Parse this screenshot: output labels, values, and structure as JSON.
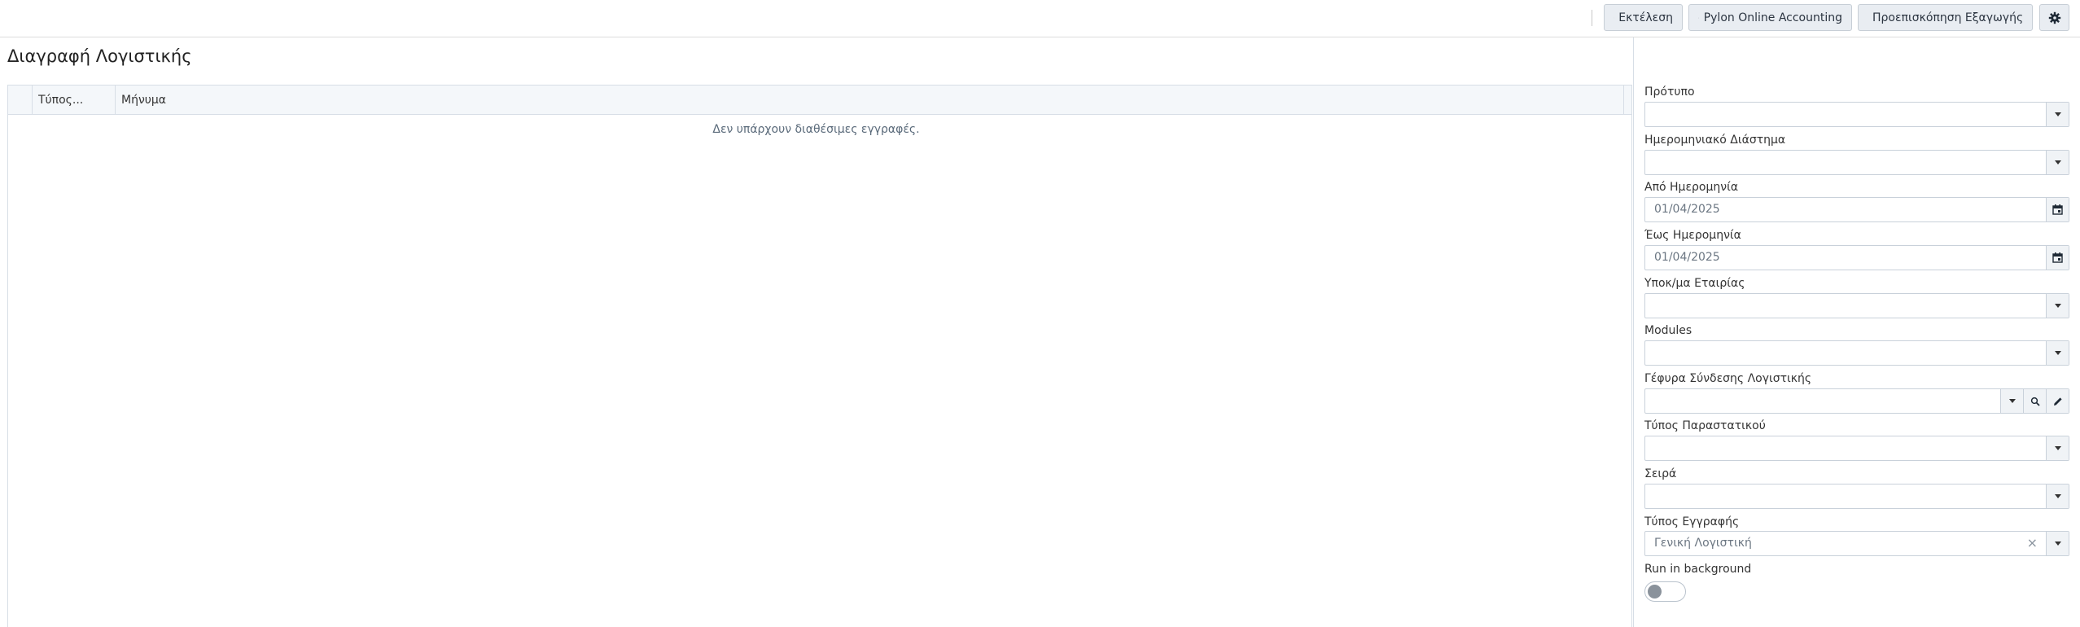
{
  "toolbar": {
    "execute_label": "Εκτέλεση",
    "pylon_label": "Pylon Online Accounting",
    "preview_label": "Προεπισκόπηση Εξαγωγής"
  },
  "page": {
    "title": "Διαγραφή Λογιστικής"
  },
  "grid": {
    "columns": [
      "Τύπος...",
      "Μήνυμα"
    ],
    "empty_text": "Δεν υπάρχουν διαθέσιμες εγγραφές."
  },
  "form": {
    "template_label": "Πρότυπο",
    "template_value": "",
    "date_range_label": "Ημερομηνιακό Διάστημα",
    "date_range_value": "",
    "from_date_label": "Από Ημερομηνία",
    "from_date_value": "01/04/2025",
    "to_date_label": "Έως Ημερομηνία",
    "to_date_value": "01/04/2025",
    "company_branch_label": "Υποκ/μα Εταιρίας",
    "company_branch_value": "",
    "modules_label": "Modules",
    "modules_value": "",
    "bridge_label": "Γέφυρα Σύνδεσης Λογιστικής",
    "bridge_value": "",
    "doc_type_label": "Τύπος Παραστατικού",
    "doc_type_value": "",
    "series_label": "Σειρά",
    "series_value": "",
    "entry_type_label": "Τύπος Εγγραφής",
    "entry_type_value": "Γενική Λογιστική",
    "run_bg_label": "Run in background",
    "run_bg_on": false
  },
  "icons": {
    "execute": "play-icon",
    "pylon": "upload-icon",
    "preview": "export-preview-icon",
    "settings": "gear-icon"
  }
}
